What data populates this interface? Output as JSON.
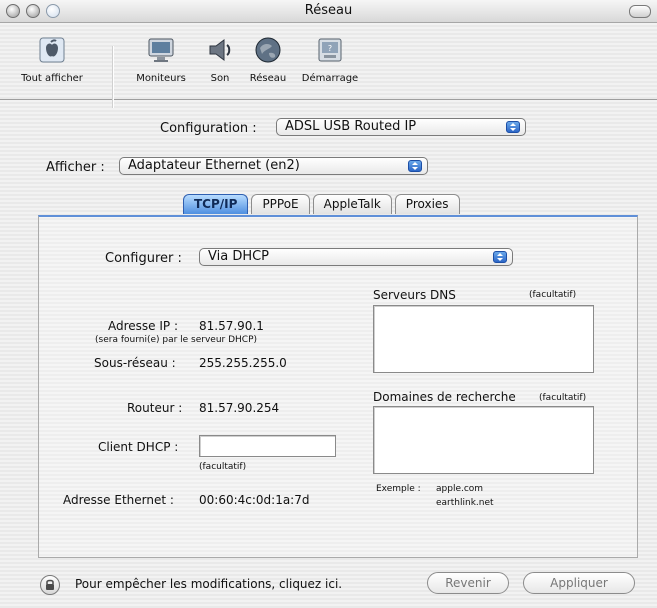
{
  "window": {
    "title": "Réseau"
  },
  "toolbar": {
    "items": [
      {
        "label": "Tout afficher",
        "icon": "apple-icon"
      },
      {
        "label": "Moniteurs",
        "icon": "monitor-icon"
      },
      {
        "label": "Son",
        "icon": "speaker-icon"
      },
      {
        "label": "Réseau",
        "icon": "globe-icon"
      },
      {
        "label": "Démarrage",
        "icon": "disk-icon"
      }
    ]
  },
  "configuration": {
    "label": "Configuration :",
    "value": "ADSL USB Routed IP"
  },
  "afficher": {
    "label": "Afficher :",
    "value": "Adaptateur Ethernet (en2)"
  },
  "tabs": [
    {
      "label": "TCP/IP",
      "active": true
    },
    {
      "label": "PPPoE",
      "active": false
    },
    {
      "label": "AppleTalk",
      "active": false
    },
    {
      "label": "Proxies",
      "active": false
    }
  ],
  "tcpip": {
    "configurer_label": "Configurer :",
    "configurer_value": "Via DHCP",
    "adresse_ip_label": "Adresse IP :",
    "adresse_ip_value": "81.57.90.1",
    "adresse_ip_note": "(sera fourni(e) par le serveur DHCP)",
    "sous_reseau_label": "Sous-réseau :",
    "sous_reseau_value": "255.255.255.0",
    "routeur_label": "Routeur :",
    "routeur_value": "81.57.90.254",
    "client_dhcp_label": "Client DHCP :",
    "client_dhcp_value": "",
    "client_dhcp_note": "(facultatif)",
    "adresse_ethernet_label": "Adresse Ethernet :",
    "adresse_ethernet_value": "00:60:4c:0d:1a:7d",
    "dns_label": "Serveurs DNS",
    "dns_optional": "(facultatif)",
    "domaines_label": "Domaines de recherche",
    "domaines_optional": "(facultatif)",
    "exemple_label": "Exemple :",
    "exemple_line1": "apple.com",
    "exemple_line2": "earthlink.net"
  },
  "bottom": {
    "lock_text": "Pour empêcher les modifications, cliquez ici.",
    "revenir_label": "Revenir",
    "appliquer_label": "Appliquer"
  }
}
